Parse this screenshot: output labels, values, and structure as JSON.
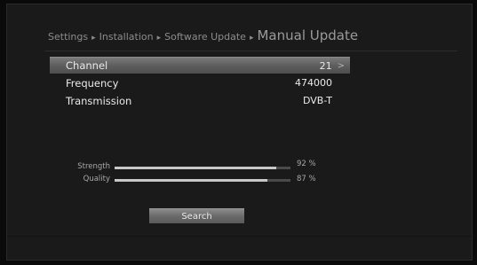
{
  "breadcrumb": {
    "items": [
      "Settings",
      "Installation",
      "Software Update"
    ],
    "separator": "▸",
    "current": "Manual Update"
  },
  "rows": [
    {
      "label": "Channel",
      "value": "21",
      "selected": true,
      "has_arrow": true
    },
    {
      "label": "Frequency",
      "value": "474000",
      "selected": false,
      "has_arrow": false
    },
    {
      "label": "Transmission",
      "value": "DVB-T",
      "selected": false,
      "has_arrow": false
    }
  ],
  "arrow_icon": "chevron-right-icon",
  "meters": {
    "strength": {
      "label": "Strength",
      "value_text": "92 %",
      "level": 0.92
    },
    "quality": {
      "label": "Quality",
      "value_text": "87 %",
      "level": 0.87
    }
  },
  "search_button": {
    "label": "Search"
  },
  "colors": {
    "background": "#1a1a1a",
    "highlight": "#6a6a6a",
    "meter_fill": "#c8c8c8"
  }
}
